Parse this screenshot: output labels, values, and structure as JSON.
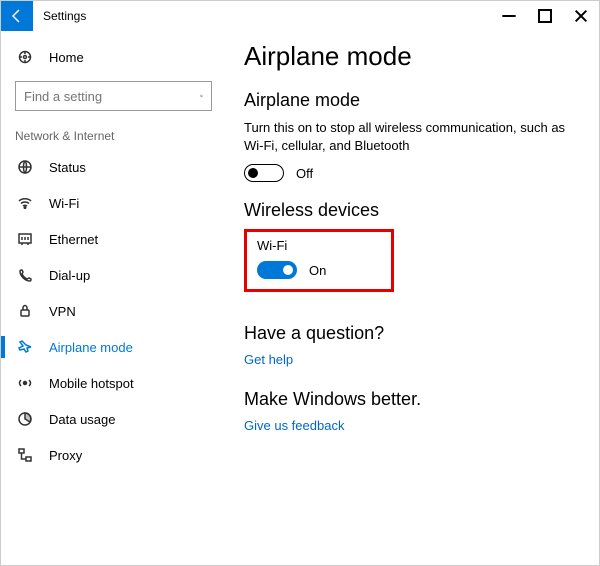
{
  "titlebar": {
    "title": "Settings"
  },
  "sidebar": {
    "home_label": "Home",
    "search_placeholder": "Find a setting",
    "section_label": "Network & Internet",
    "items": [
      {
        "label": "Status"
      },
      {
        "label": "Wi-Fi"
      },
      {
        "label": "Ethernet"
      },
      {
        "label": "Dial-up"
      },
      {
        "label": "VPN"
      },
      {
        "label": "Airplane mode"
      },
      {
        "label": "Mobile hotspot"
      },
      {
        "label": "Data usage"
      },
      {
        "label": "Proxy"
      }
    ]
  },
  "content": {
    "page_title": "Airplane mode",
    "section1_title": "Airplane mode",
    "section1_desc": "Turn this on to stop all wireless communication, such as Wi-Fi, cellular, and Bluetooth",
    "airplane_toggle_label": "Off",
    "section2_title": "Wireless devices",
    "wifi_label": "Wi-Fi",
    "wifi_toggle_label": "On",
    "question_title": "Have a question?",
    "help_link": "Get help",
    "feedback_title": "Make Windows better.",
    "feedback_link": "Give us feedback"
  }
}
